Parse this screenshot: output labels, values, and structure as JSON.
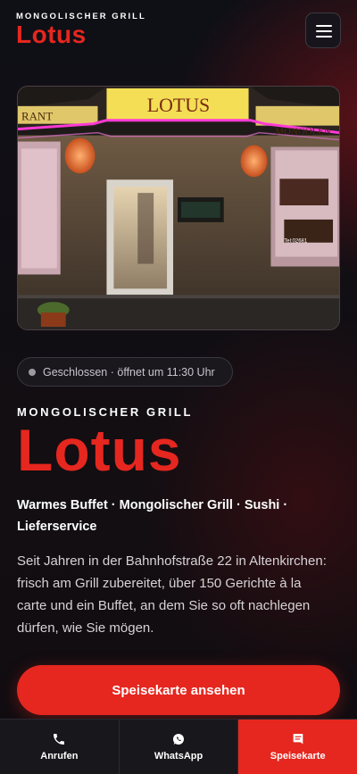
{
  "header": {
    "subtitle": "MONGOLISCHER GRILL",
    "title": "Lotus"
  },
  "hero": {
    "sign_text": "LOTUS",
    "left_fascia": "RANT",
    "right_fascia": "MONGOLEN",
    "window_sign": "Tel:02681"
  },
  "status": {
    "text": "Geschlossen · öffnet um 11:30 Uhr",
    "dot_color": "#9a9aa0"
  },
  "intro": {
    "subtitle": "MONGOLISCHER GRILL",
    "title": "Lotus",
    "tagline": "Warmes Buffet · Mongolischer Grill · Sushi · Lieferservice",
    "description": "Seit Jahren in der Bahnhofstraße 22 in Altenkirchen: frisch am Grill zubereitet, über 150 Gerichte à la carte und ein Buffet, an dem Sie so oft nachlegen dürfen, wie Sie mögen."
  },
  "cta": {
    "label": "Speisekarte ansehen"
  },
  "bottom_nav": {
    "items": [
      {
        "label": "Anrufen",
        "icon": "phone-icon"
      },
      {
        "label": "WhatsApp",
        "icon": "whatsapp-icon"
      },
      {
        "label": "Speisekarte",
        "icon": "menu-book-icon"
      }
    ]
  },
  "colors": {
    "accent": "#e5271f",
    "background": "#0f0f16",
    "neon": "#ff3ad6"
  }
}
